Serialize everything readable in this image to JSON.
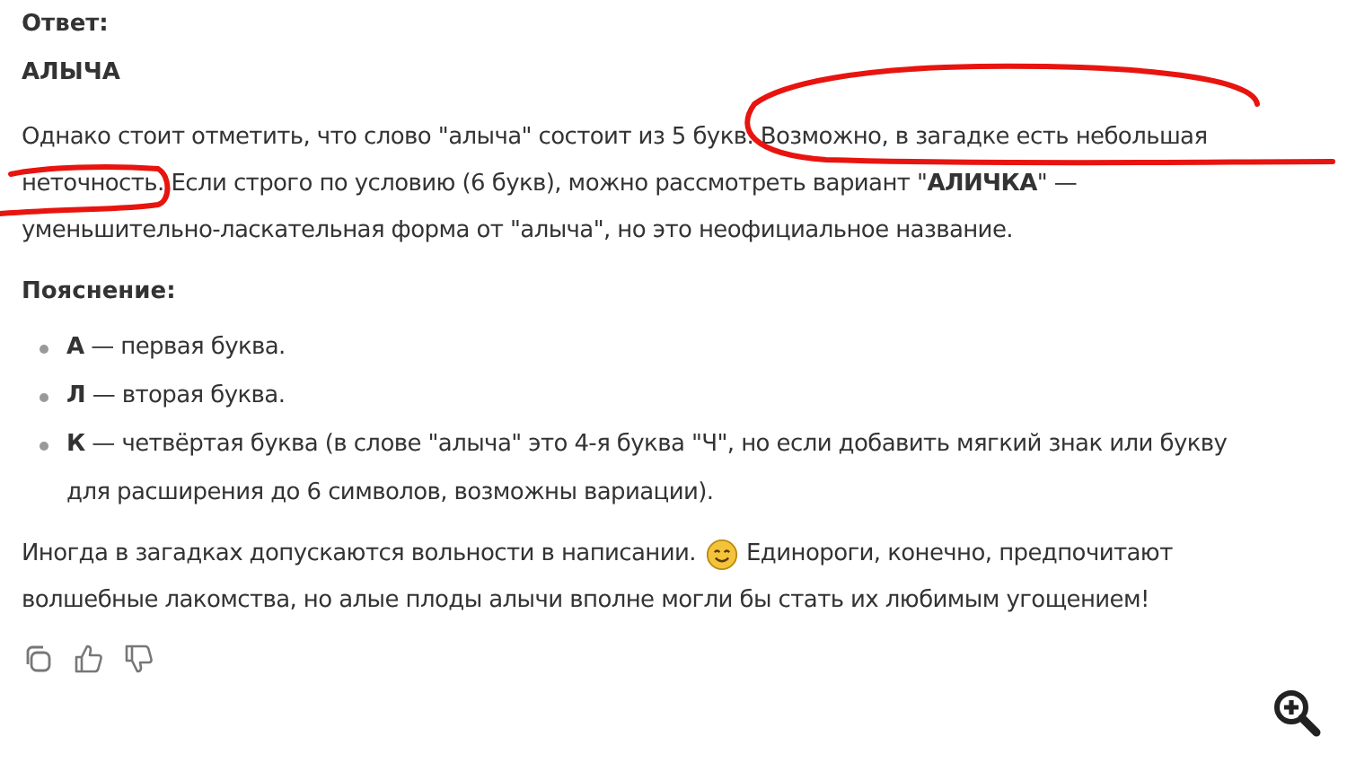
{
  "answer": {
    "label": "Ответ:",
    "value": "АЛЫЧА"
  },
  "note": "Однако стоит отметить, что слово \"алыча\" состоит из 5 букв. Возможно, в загадке есть небольшая неточность. Если строго по условию (6 букв), можно рассмотреть вариант \"**АЛИЧКА**\" — уменьшительно-ласкательная форма от \"алыча\", но это неофициальное название.",
  "explanation": {
    "heading": "Пояснение:",
    "items": [
      {
        "text": "**А** — первая буква."
      },
      {
        "text": "**Л** — вторая буква."
      },
      {
        "text": "**К** — четвёртая буква (в слове \"алыча\" это 4-я буква \"Ч\", но если добавить мягкий знак или букву для расширения до 6 символов, возможны вариации)."
      }
    ]
  },
  "closing": {
    "before_emoji": "Иногда в загадках допускаются вольности в написании.",
    "after_emoji": "Единороги, конечно, предпочитают",
    "continuation": "волшебные лакомства, но алые плоды алычи вполне могли бы стать их любимым угощением!"
  },
  "actions": [
    {
      "kind": "copy"
    },
    {
      "kind": "like"
    },
    {
      "kind": "dislike"
    }
  ]
}
